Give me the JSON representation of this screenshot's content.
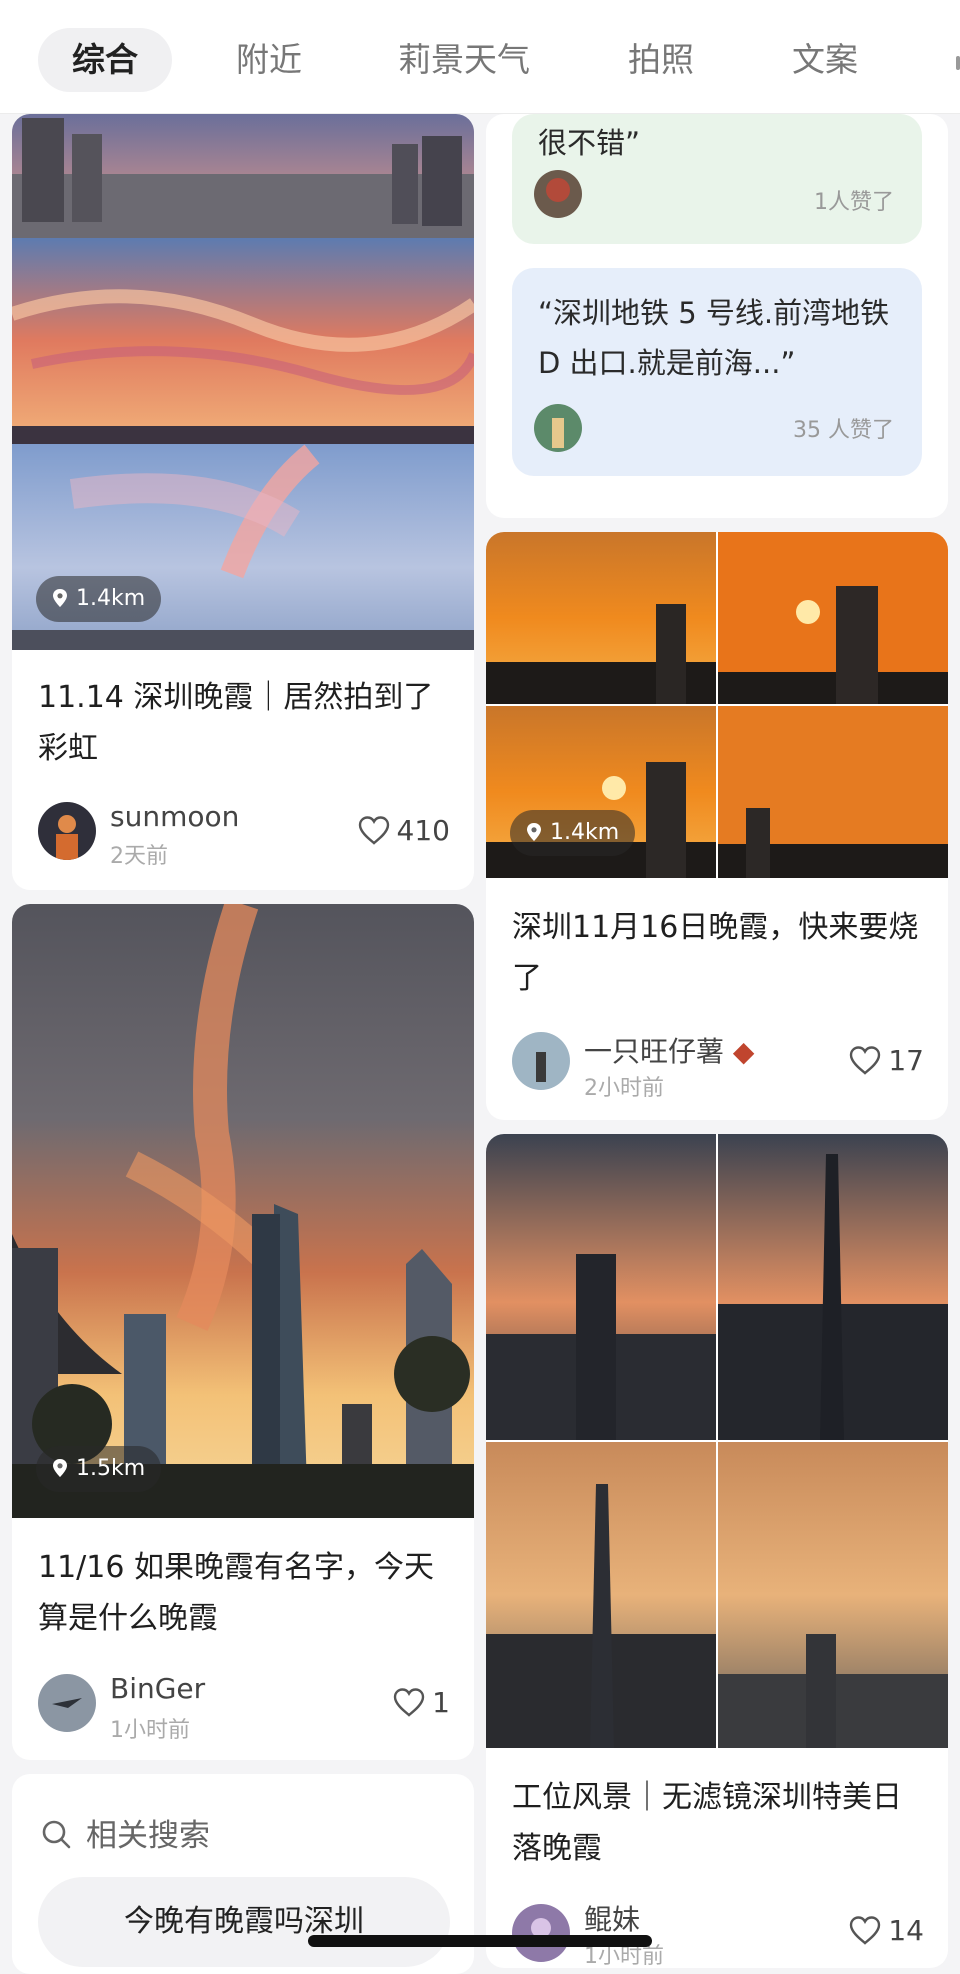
{
  "tabs": [
    "综合",
    "附近",
    "莉景天气",
    "拍照",
    "文案"
  ],
  "cards": {
    "c1": {
      "distance": "1.4km",
      "title": "11.14 深圳晚霞｜居然拍到了彩虹",
      "author": "sunmoon",
      "time": "2天前",
      "likes": "410"
    },
    "c2": {
      "distance": "1.5km",
      "title": "11/16 如果晚霞有名字，今天算是什么晚霞",
      "author": "BinGer",
      "time": "1小时前",
      "likes": "1"
    },
    "c3": {
      "distance": "1.4km",
      "title": "深圳11月16日晚霞，快来要烧了",
      "author": "一只旺仔薯",
      "time": "2小时前",
      "likes": "17"
    },
    "c4": {
      "title": "工位风景｜无滤镜深圳特美日落晚霞",
      "author": "鲲妹",
      "time": "1小时前",
      "likes": "14"
    }
  },
  "quotes": {
    "q1": {
      "text": "很不错”",
      "likes": "1人赞了",
      "bg": "#e9f4ea"
    },
    "q2": {
      "text": "“深圳地铁 5 号线.前湾地铁 D 出口.就是前海...”",
      "likes": "35 人赞了",
      "bg": "#e6eefa"
    }
  },
  "related": {
    "label": "相关搜索",
    "suggestion": "今晚有晚霞吗深圳"
  },
  "icons": {
    "location": "location-pin-icon",
    "like": "heart-outline-icon",
    "search": "search-icon"
  }
}
